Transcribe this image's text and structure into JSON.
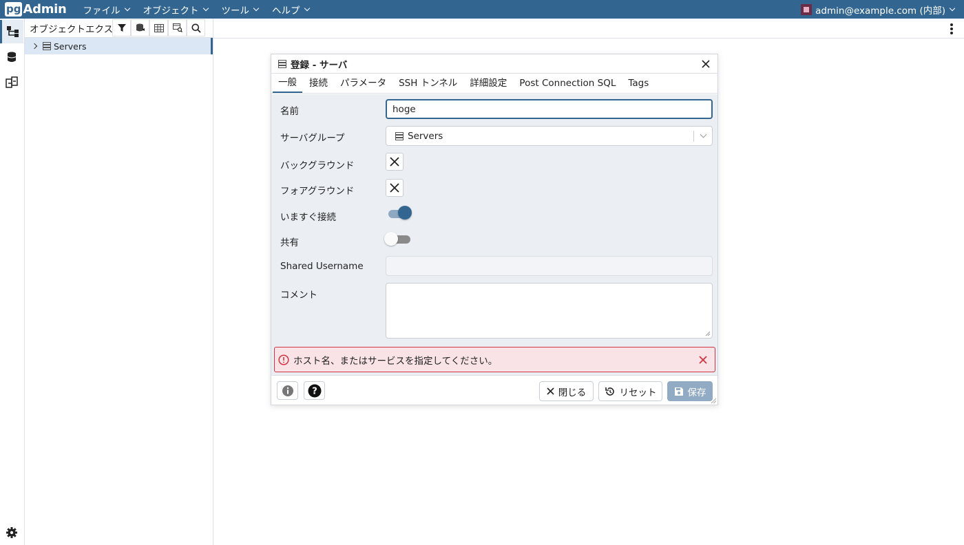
{
  "app": {
    "logo_box": "pg",
    "logo_text": "Admin"
  },
  "menubar": {
    "items": [
      {
        "label": "ファイル"
      },
      {
        "label": "オブジェクト"
      },
      {
        "label": "ツール"
      },
      {
        "label": "ヘルプ"
      }
    ],
    "user": "admin@example.com (内部)"
  },
  "explorer": {
    "title": "オブジェクトエクスプローラ",
    "tree": [
      {
        "label": "Servers",
        "icon": "server-group-icon"
      }
    ]
  },
  "dialog": {
    "title": "登録 - サーバ",
    "tabs": [
      {
        "label": "一般",
        "active": true
      },
      {
        "label": "接続"
      },
      {
        "label": "パラメータ"
      },
      {
        "label": "SSH トンネル"
      },
      {
        "label": "詳細設定"
      },
      {
        "label": "Post Connection SQL"
      },
      {
        "label": "Tags"
      }
    ],
    "fields": {
      "name_label": "名前",
      "name_value": "hoge",
      "group_label": "サーバグループ",
      "group_value": "Servers",
      "bg_label": "バックグラウンド",
      "fg_label": "フォアグラウンド",
      "connect_now_label": "いますぐ接続",
      "connect_now": true,
      "shared_label": "共有",
      "shared": false,
      "shared_username_label": "Shared Username",
      "shared_username_value": "",
      "comment_label": "コメント",
      "comment_value": ""
    },
    "error": "ホスト名、またはサービスを指定してください。",
    "buttons": {
      "close": "閉じる",
      "reset": "リセット",
      "save": "保存"
    }
  },
  "colors": {
    "brand": "#326690",
    "error": "#d1333f",
    "error_bg": "#fae3e6"
  }
}
